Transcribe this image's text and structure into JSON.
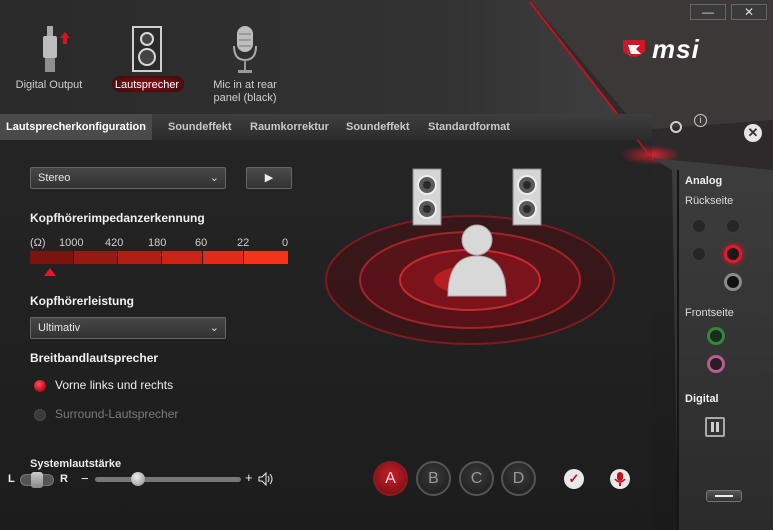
{
  "window": {
    "minimize_label": "—",
    "close_label": "✕"
  },
  "brand": {
    "logo_text": "msi"
  },
  "devices": [
    {
      "label": "Digital Output",
      "icon": "digital-output-icon"
    },
    {
      "label": "Lautsprecher",
      "icon": "speaker-icon",
      "active": true
    },
    {
      "label": "Mic in at rear panel (black)",
      "icon": "microphone-icon"
    }
  ],
  "tabs": [
    "Lautsprecherkonfiguration",
    "Soundeffekt",
    "Raumkorrektur",
    "Soundeffekt",
    "Standardformat"
  ],
  "config": {
    "selected": "Stereo",
    "play_label": "▶"
  },
  "impedance": {
    "heading": "Kopfhörerimpedanzerkennung",
    "scale": [
      "(Ω)",
      "1000",
      "420",
      "180",
      "60",
      "22",
      "0"
    ]
  },
  "power": {
    "heading": "Kopfhörerleistung",
    "selected": "Ultimativ"
  },
  "broadband": {
    "heading": "Breitbandlautsprecher",
    "options": [
      {
        "label": "Vorne links und rechts",
        "selected": true
      },
      {
        "label": "Surround-Lautsprecher",
        "selected": false
      }
    ]
  },
  "volume": {
    "label": "Systemlautstärke",
    "left": "L",
    "right": "R",
    "minus": "−",
    "plus": "+",
    "level": 0.27,
    "balance": 0.5
  },
  "profiles": [
    "A",
    "B",
    "C",
    "D"
  ],
  "right_panel": {
    "analog": "Analog",
    "rear": "Rückseite",
    "front": "Frontseite",
    "digital": "Digital"
  },
  "colors": {
    "accent": "#e8162b",
    "impedance_bar": "#d4231b",
    "jack_green": "#2f8a3c",
    "jack_pink": "#b4608e"
  }
}
